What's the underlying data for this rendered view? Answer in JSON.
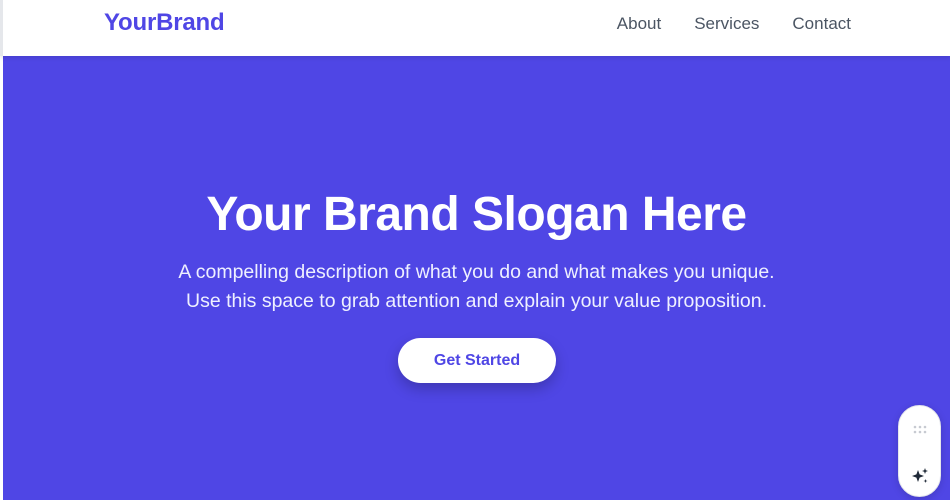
{
  "header": {
    "brand": "YourBrand",
    "nav": [
      "About",
      "Services",
      "Contact"
    ]
  },
  "hero": {
    "title": "Your Brand Slogan Here",
    "description_line1": "A compelling description of what you do and what makes you unique.",
    "description_line2": "Use this space to grab attention and explain your value proposition.",
    "cta_label": "Get Started"
  },
  "colors": {
    "accent": "#4f46e5",
    "nav_text": "#4b5563",
    "hero_bg": "#4f46e5",
    "cta_bg": "#ffffff"
  },
  "widget": {
    "icons": [
      "drag-handle-icon",
      "sparkle-icon"
    ]
  }
}
